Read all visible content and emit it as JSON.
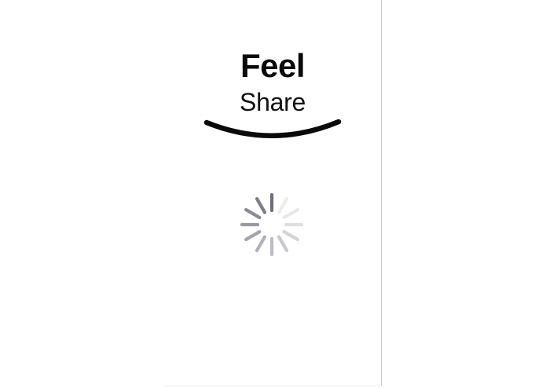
{
  "logo": {
    "title": "Feel",
    "subtitle": "Share"
  },
  "loading_indicator": {
    "icon": "spinner-icon",
    "spokes": 12
  },
  "colors": {
    "background": "#ffffff",
    "text": "#0a0a0a",
    "spinner": "#6e6e7a",
    "divider": "#c8c8c8"
  }
}
